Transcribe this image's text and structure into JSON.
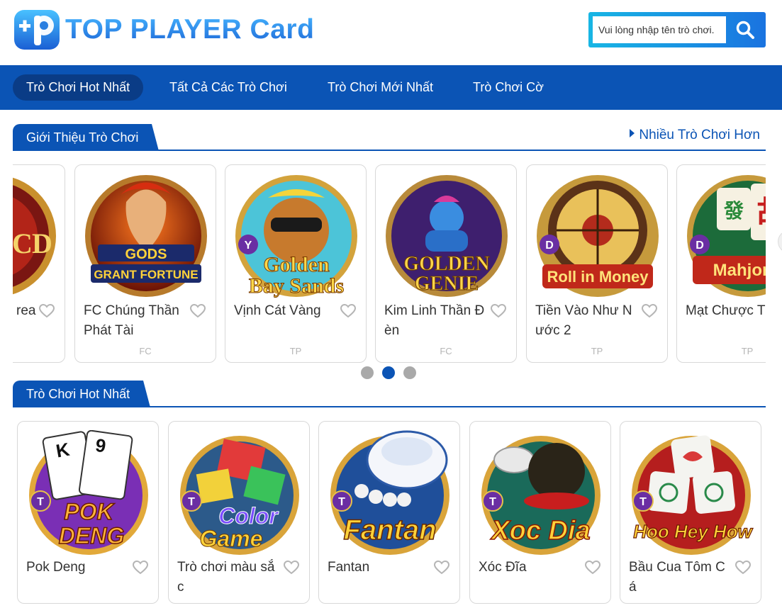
{
  "brand": {
    "name": "TOP PLAYER Card"
  },
  "search": {
    "placeholder": "Vui lòng nhập tên trò chơi."
  },
  "nav": [
    {
      "label": "Trò Chơi Hot Nhất",
      "active": true
    },
    {
      "label": "Tất Cả Các Trò Chơi",
      "active": false
    },
    {
      "label": "Trò Chơi Mới Nhất",
      "active": false
    },
    {
      "label": "Trò Chơi Cờ",
      "active": false
    }
  ],
  "intro": {
    "title": "Giới Thiệu Trò Chơi",
    "more": "Nhiều Trò Chơi Hơn",
    "cards": [
      {
        "name": "rea",
        "provider": "",
        "art": "partial-red"
      },
      {
        "name": "FC Chúng Thần Phát Tài",
        "provider": "FC",
        "art": "gods-grant-fortune",
        "art_text": [
          "GODS",
          "GRANT FORTUNE"
        ]
      },
      {
        "name": "Vịnh Cát Vàng",
        "provider": "TP",
        "art": "golden-bay-sands",
        "art_text": [
          "Golden",
          "Bay Sands"
        ],
        "badge": "Y"
      },
      {
        "name": "Kim Linh Thần Đ èn",
        "provider": "FC",
        "art": "golden-genie",
        "art_text": [
          "GOLDEN",
          "GENIE"
        ]
      },
      {
        "name": "Tiền Vào Như N ước 2",
        "provider": "TP",
        "art": "roll-in-money",
        "art_text": [
          "Roll in Money"
        ],
        "badge": "D"
      },
      {
        "name": "Mạt Chược T g",
        "provider": "TP",
        "art": "mahjong",
        "art_text": [
          "Mahjong"
        ],
        "badge": "D"
      }
    ],
    "pages": 3,
    "active_page": 2
  },
  "hot": {
    "title": "Trò Chơi Hot Nhất",
    "cards": [
      {
        "name": "Pok Deng",
        "art": "pok-deng",
        "art_text": [
          "POK",
          "DENG"
        ],
        "badge": "T"
      },
      {
        "name": "Trò chơi màu sắ c",
        "art": "color-game",
        "art_text": [
          "Color",
          "Game"
        ],
        "badge": "T"
      },
      {
        "name": "Fantan",
        "art": "fantan",
        "art_text": [
          "Fantan"
        ],
        "badge": "T"
      },
      {
        "name": "Xóc Đĩa",
        "art": "xoc-dia",
        "art_text": [
          "Xoc Dia"
        ],
        "badge": "T"
      },
      {
        "name": "Bầu Cua Tôm C á",
        "art": "hoo-hey-how",
        "art_text": [
          "Hoo Hey How"
        ],
        "badge": "T"
      }
    ]
  },
  "colors": {
    "primary": "#0b54b5",
    "primary_dark": "#0a3c86",
    "accent": "#2b8be6"
  }
}
